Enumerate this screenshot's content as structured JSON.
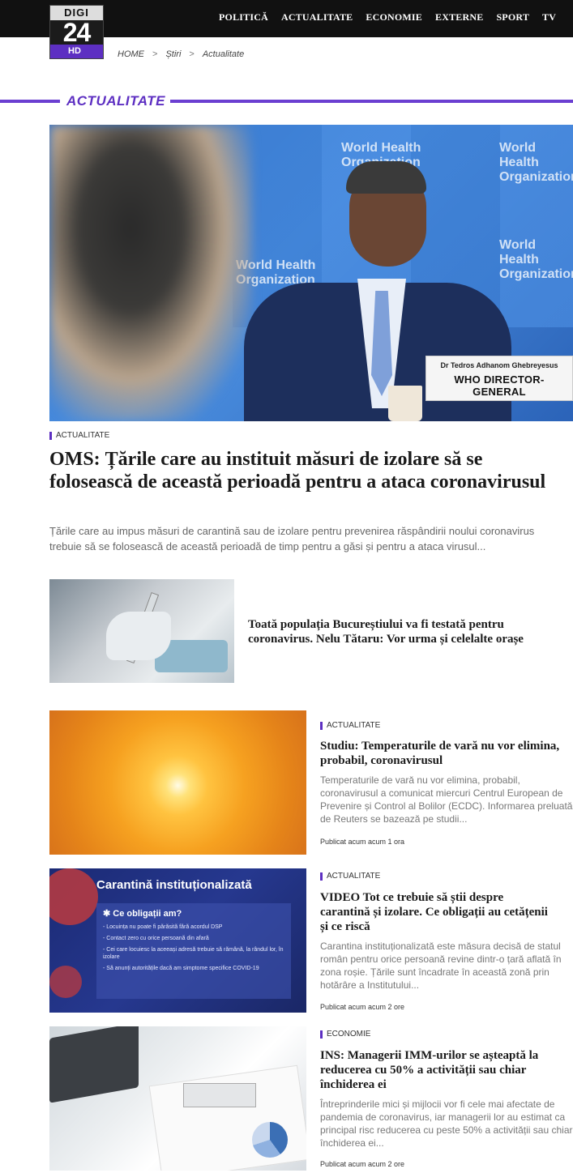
{
  "logo": {
    "line1": "DIGI",
    "line2": "24",
    "line3": "HD"
  },
  "nav": [
    "POLITICĂ",
    "ACTUALITATE",
    "ECONOMIE",
    "EXTERNE",
    "SPORT",
    "TV"
  ],
  "breadcrumb": {
    "home": "HOME",
    "news": "Știri",
    "current": "Actualitate",
    "sep": ">"
  },
  "section": {
    "title": "ACTUALITATE"
  },
  "hero": {
    "image_text": {
      "nameplate_small": "Dr Tedros Adhanom Ghebreyesus",
      "nameplate_big": "WHO DIRECTOR-GENERAL",
      "wall1": "World Health\nOrganization"
    },
    "category": "ACTUALITATE",
    "title": "OMS: Țările care au instituit măsuri de izolare să se folosească de această perioadă pentru a ataca coronavirusul",
    "desc_line1": "Țările care au impus măsuri de carantină sau de izolare pentru prevenirea răspândirii noului coronavirus",
    "desc_line2": "trebuie să se folosească de această perioadă de timp pentru a găsi și pentru a ataca virusul..."
  },
  "articles": [
    {
      "title": "Toată populația Bucureștiului va fi testată pentru coronavirus. Nelu Tătaru: Vor urma și celelalte orașe"
    },
    {
      "category": "ACTUALITATE",
      "title": "Studiu: Temperaturile de vară nu vor elimina, probabil, coronavirusul",
      "desc": "Temperaturile de vară nu vor elimina, probabil, coronavirusul a comunicat miercuri Centrul European de Prevenire și Control al Bolilor (ECDC). Informarea preluată de Reuters se bazează pe studii...",
      "published": "Publicat acum acum 1 ora"
    },
    {
      "category": "ACTUALITATE",
      "title": "VIDEO Tot ce trebuie să știi despre carantină și izolare. Ce obligații au cetățenii și ce riscă",
      "desc": "Carantina instituționalizată este măsura decisă de statul român pentru orice persoană revine dintr-o țară aflată în zona roșie. Țările sunt încadrate în această zonă prin hotărâre a Institutului...",
      "published": "Publicat acum acum 2 ore",
      "image_text": {
        "title": "Carantină instituționalizată",
        "head": "✱ Ce obligații am?",
        "items": [
          "- Locuința nu poate fi părăsită fără acordul DSP",
          "- Contact zero cu orice persoană din afară",
          "- Cei care locuiesc la aceeași adresă trebuie să rămână, la rândul lor, în izolare",
          "- Să anunți autoritățile dacă am simptome specifice COVID-19"
        ]
      }
    },
    {
      "category": "ECONOMIE",
      "title": "INS: Managerii IMM-urilor se așteaptă la reducerea cu 50% a activității sau chiar închiderea ei",
      "desc": "Întreprinderile mici și mijlocii vor fi cele mai afectate de pandemia de coronavirus, iar managerii lor au estimat ca principal risc reducerea cu peste 50% a activității sau chiar închiderea ei...",
      "published": "Publicat acum acum 2 ore"
    }
  ],
  "colors": {
    "accent": "#5d2fc2",
    "topbar": "#111111"
  }
}
